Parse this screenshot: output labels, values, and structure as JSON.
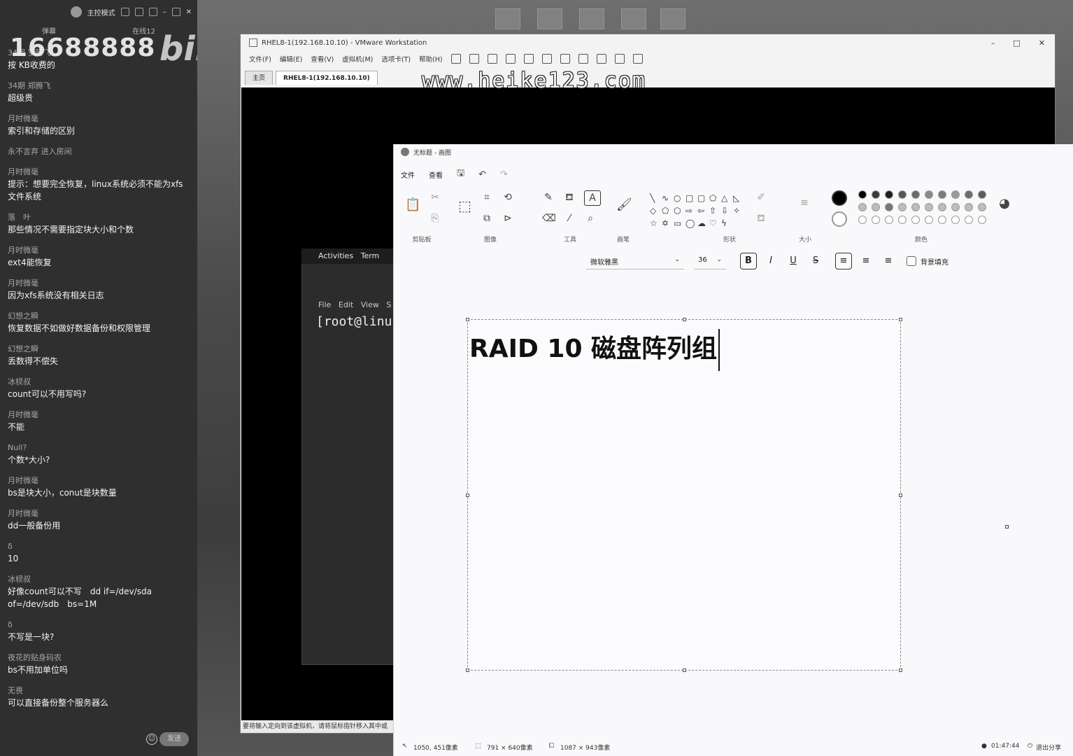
{
  "chat": {
    "mode": "主控模式",
    "tab_left": "弹幕",
    "tab_right": "在线12",
    "watermark_number": "16688888",
    "watermark_brand": "bilibili",
    "messages": [
      {
        "name": "34期 罗腾飞",
        "text": "按 KB收费的"
      },
      {
        "name": "34期 郑腾飞",
        "text": "超级贵"
      },
      {
        "name": "月时微毫",
        "text": "索引和存储的区别"
      },
      {
        "name": "永不言弃 进入房间",
        "text": ""
      },
      {
        "name": "月时微毫",
        "text": "提示：想要完全恢复，linux系统必须不能为xfs文件系统"
      },
      {
        "name": "落　叶",
        "text": "那些情况不需要指定块大小和个数"
      },
      {
        "name": "月时微毫",
        "text": "ext4能恢复"
      },
      {
        "name": "月时微毫",
        "text": "因为xfs系统没有相关日志"
      },
      {
        "name": "幻想之瞬",
        "text": "恢复数据不如做好数据备份和权限管理"
      },
      {
        "name": "幻想之瞬",
        "text": "丢数得不偿失"
      },
      {
        "name": "冰棂叔",
        "text": "count可以不用写吗?"
      },
      {
        "name": "月时微毫",
        "text": "不能"
      },
      {
        "name": "Null?",
        "text": "个数*大小?"
      },
      {
        "name": "月时微毫",
        "text": "bs是块大小，conut是块数量"
      },
      {
        "name": "月时微毫",
        "text": "dd一般备份用"
      },
      {
        "name": "δ",
        "text": "10"
      },
      {
        "name": "冰棂叔",
        "text": "好像count可以不写　dd if=/dev/sda　of=/dev/sdb　bs=1M"
      },
      {
        "name": "δ",
        "text": "不写是一块?"
      },
      {
        "name": "夜花的贴身码农",
        "text": "bs不用加单位吗"
      },
      {
        "name": "无畏",
        "text": "可以直接备份整个服务器么"
      }
    ],
    "send_label": "发送"
  },
  "watermark_url": "www.heike123.com",
  "vmware": {
    "title": "RHEL8-1(192.168.10.10) - VMware Workstation",
    "menu": [
      "文件(F)",
      "编辑(E)",
      "查看(V)",
      "虚拟机(M)",
      "选项卡(T)",
      "帮助(H)"
    ],
    "tabs": [
      "主页",
      "RHEL8-1(192.168.10.10)"
    ],
    "gnome_activities": "Activities",
    "gnome_app": "Term",
    "terminal_menu": [
      "File",
      "Edit",
      "View",
      "S"
    ],
    "terminal_prompt": "[root@linu",
    "status_text": "要将输入定向到该虚拟机，请将鼠标指针移入其中或"
  },
  "paint": {
    "title": "无标题 - 画图",
    "menu": [
      "文件",
      "查看"
    ],
    "groups": {
      "clipboard": "剪贴板",
      "image": "图像",
      "tools": "工具",
      "brushes": "画笔",
      "shapes": "形状",
      "size": "大小",
      "colors": "颜色"
    },
    "font_name": "微软雅黑",
    "font_size": "36",
    "bg_fill_label": "背景填充",
    "canvas_text": "RAID 10 磁盘阵列组",
    "status": {
      "cursor_pos": "1050, 451像素",
      "selection": "791 × 640像素",
      "canvas_size": "1087 × 943像素",
      "time": "01:47:44",
      "exit_share": "退出分享"
    },
    "colors": [
      "#000000",
      "#3a3a3a",
      "#1e1e1e",
      "#555555",
      "#6a6a6a",
      "#8a8a8a",
      "#7a7a7a",
      "#9a9a9a",
      "#6e6e6e",
      "#5c5c5c"
    ]
  }
}
